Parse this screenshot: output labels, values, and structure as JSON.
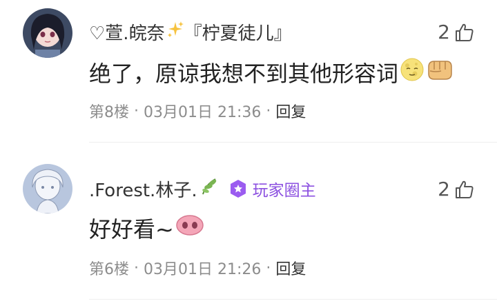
{
  "comments": [
    {
      "username": "♡萱.皖奈",
      "username_suffix": "『柠夏徒儿』",
      "text": "绝了，原谅我想不到其他形容词",
      "likes": "2",
      "floor": "第8楼",
      "date": "03月01日 21:36",
      "reply_label": "回复",
      "sep": "·",
      "name_icon": "sparkles-icon",
      "emojis": [
        "moon-face-icon",
        "fist-icon"
      ]
    },
    {
      "username": ".Forest.林子.",
      "badge": "玩家圈主",
      "text": "好好看~",
      "likes": "2",
      "floor": "第6楼",
      "date": "03月01日 21:26",
      "reply_label": "回复",
      "sep": "·",
      "name_icon": "leaf-icon",
      "emojis": [
        "pig-nose-icon"
      ]
    }
  ],
  "colors": {
    "badge_purple": "#8b4fe0",
    "meta_gray": "#8c8c8c",
    "text_dark": "#222222",
    "divider": "#eeeeee"
  }
}
